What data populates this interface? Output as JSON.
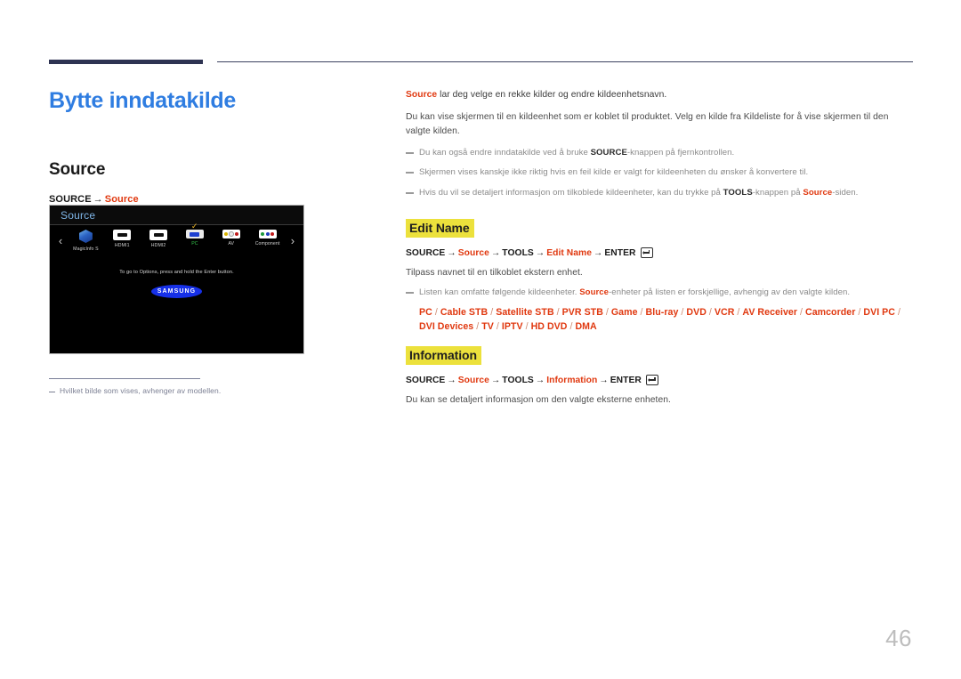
{
  "page": {
    "number": "46",
    "title": "Bytte inndatakilde",
    "accent_blue": "#2f7de1",
    "accent_red": "#e0380f",
    "highlight_yellow": "#ece13c",
    "rule_navy": "#2e3352"
  },
  "left": {
    "section_heading": "Source",
    "path": {
      "step1": "SOURCE",
      "arrow": "→",
      "step2": "Source"
    },
    "footnote": "Hvilket bilde som vises, avhenger av modellen."
  },
  "tv_screenshot": {
    "window_title": "Source",
    "prev_chevron": "‹",
    "next_chevron": "›",
    "check_mark": "✓",
    "sources": [
      {
        "label": "MagicInfo S",
        "icon": "magicinfo-cube-icon",
        "selected": false
      },
      {
        "label": "HDMI1",
        "icon": "hdmi-port-icon",
        "selected": false
      },
      {
        "label": "HDMI2",
        "icon": "hdmi-port-icon",
        "selected": false
      },
      {
        "label": "PC",
        "icon": "vga-port-icon",
        "selected": true
      },
      {
        "label": "AV",
        "icon": "av-rca-icon",
        "selected": false
      },
      {
        "label": "Component",
        "icon": "component-rca-icon",
        "selected": false
      }
    ],
    "hint": "To go to Options, press and hold the Enter button.",
    "brand_logo": "SAMSUNG"
  },
  "right": {
    "intro": {
      "lead": "Source",
      "rest": " lar deg velge en rekke kilder og endre kildeenhetsnavn."
    },
    "paragraph": "Du kan vise skjermen til en kildeenhet som er koblet til produktet. Velg en kilde fra Kildeliste for å vise skjermen til den valgte kilden.",
    "notes": [
      {
        "pre": "Du kan også endre inndatakilde ved å bruke ",
        "bold": "SOURCE",
        "post": "-knappen på fjernkontrollen."
      },
      {
        "pre": "Skjermen vises kanskje ikke riktig hvis en feil kilde er valgt for kildeenheten du ønsker å konvertere til.",
        "bold": "",
        "post": ""
      },
      {
        "pre": "Hvis du vil se detaljert informasjon om tilkoblede kildeenheter, kan du trykke på ",
        "bold": "TOOLS",
        "post": "-knappen på ",
        "red": "Source",
        "tail": "-siden."
      }
    ],
    "edit_name": {
      "heading": "Edit Name",
      "path": {
        "step1": "SOURCE",
        "step2": "Source",
        "step3": "TOOLS",
        "step4": "Edit Name",
        "step5": "ENTER",
        "arrow": "→"
      },
      "description": "Tilpass navnet til en tilkoblet ekstern enhet.",
      "note": {
        "pre": "Listen kan omfatte følgende kildeenheter. ",
        "red": "Source",
        "post": "-enheter på listen er forskjellige, avhengig av den valgte kilden."
      },
      "device_list": [
        "PC",
        "Cable STB",
        "Satellite STB",
        "PVR STB",
        "Game",
        "Blu-ray",
        "DVD",
        "VCR",
        "AV Receiver",
        "Camcorder",
        "DVI PC",
        "DVI Devices",
        "TV",
        "IPTV",
        "HD DVD",
        "DMA"
      ],
      "device_separator": "/"
    },
    "information": {
      "heading": "Information",
      "path": {
        "step1": "SOURCE",
        "step2": "Source",
        "step3": "TOOLS",
        "step4": "Information",
        "step5": "ENTER",
        "arrow": "→"
      },
      "description": "Du kan se detaljert informasjon om den valgte eksterne enheten."
    }
  }
}
